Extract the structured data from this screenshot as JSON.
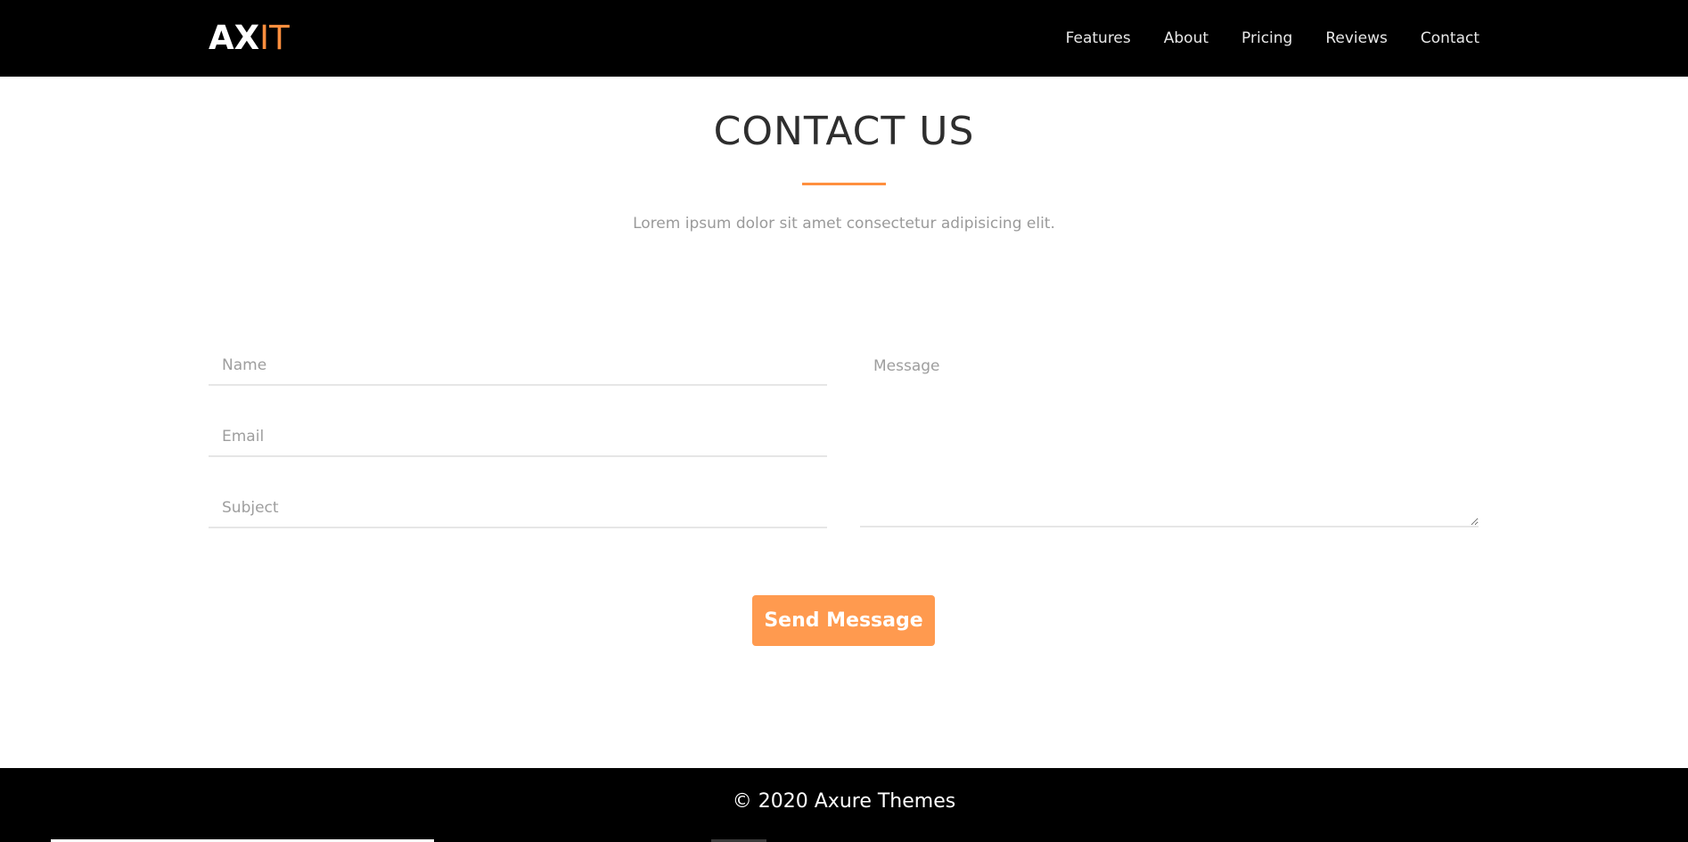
{
  "header": {
    "logo_part1": "AX",
    "logo_part2": "IT",
    "nav": [
      "Features",
      "About",
      "Pricing",
      "Reviews",
      "Contact"
    ]
  },
  "contact": {
    "title": "CONTACT US",
    "subtitle": "Lorem ipsum dolor sit amet consectetur adipisicing elit.",
    "form": {
      "name_placeholder": "Name",
      "email_placeholder": "Email",
      "subject_placeholder": "Subject",
      "message_placeholder": "Message",
      "name_value": "",
      "email_value": "",
      "subject_value": "",
      "message_value": "",
      "submit_label": "Send Message"
    }
  },
  "footer": {
    "copyright": "© 2020 Axure Themes"
  },
  "colors": {
    "accent": "#ff8f3e",
    "button": "#ff9a4f",
    "header_bg": "#000000",
    "footer_bg": "#000000",
    "title_text": "#2e2e2e",
    "muted_text": "#9a9a9a"
  }
}
